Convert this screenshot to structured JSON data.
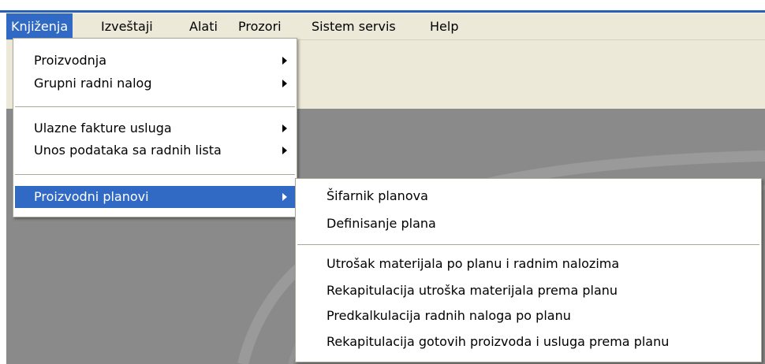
{
  "menubar": {
    "items": [
      {
        "label": "Knjiženja"
      },
      {
        "label": "Izveštaji"
      },
      {
        "label": "Alati"
      },
      {
        "label": "Prozori"
      },
      {
        "label": "Sistem servis"
      },
      {
        "label": "Help"
      }
    ],
    "active": "Knjiženja"
  },
  "menu": {
    "items": [
      {
        "label": "Proizvodnja"
      },
      {
        "label": "Grupni radni nalog"
      },
      {
        "label": "Ulazne fakture usluga"
      },
      {
        "label": "Unos podataka sa radnih lista"
      },
      {
        "label": "Proizvodni planovi"
      }
    ],
    "highlighted": "Proizvodni planovi"
  },
  "submenu": {
    "items": [
      {
        "label": "Šifarnik planova"
      },
      {
        "label": "Definisanje plana"
      },
      {
        "label": "Utrošak materijala po planu i radnim nalozima"
      },
      {
        "label": "Rekapitulacija utroška materijala prema planu"
      },
      {
        "label": "Predkalkulacija radnih naloga po planu"
      },
      {
        "label": "Rekapitulacija gotovih proizvoda i usluga prema planu"
      }
    ]
  },
  "icons": {
    "submenu_arrow": "submenu-arrow-icon"
  },
  "colors": {
    "menubar": "#ece9d8",
    "highlight": "#316ac5",
    "workspace": "#8a8a8a",
    "titlebar": "#2a5fb8"
  }
}
